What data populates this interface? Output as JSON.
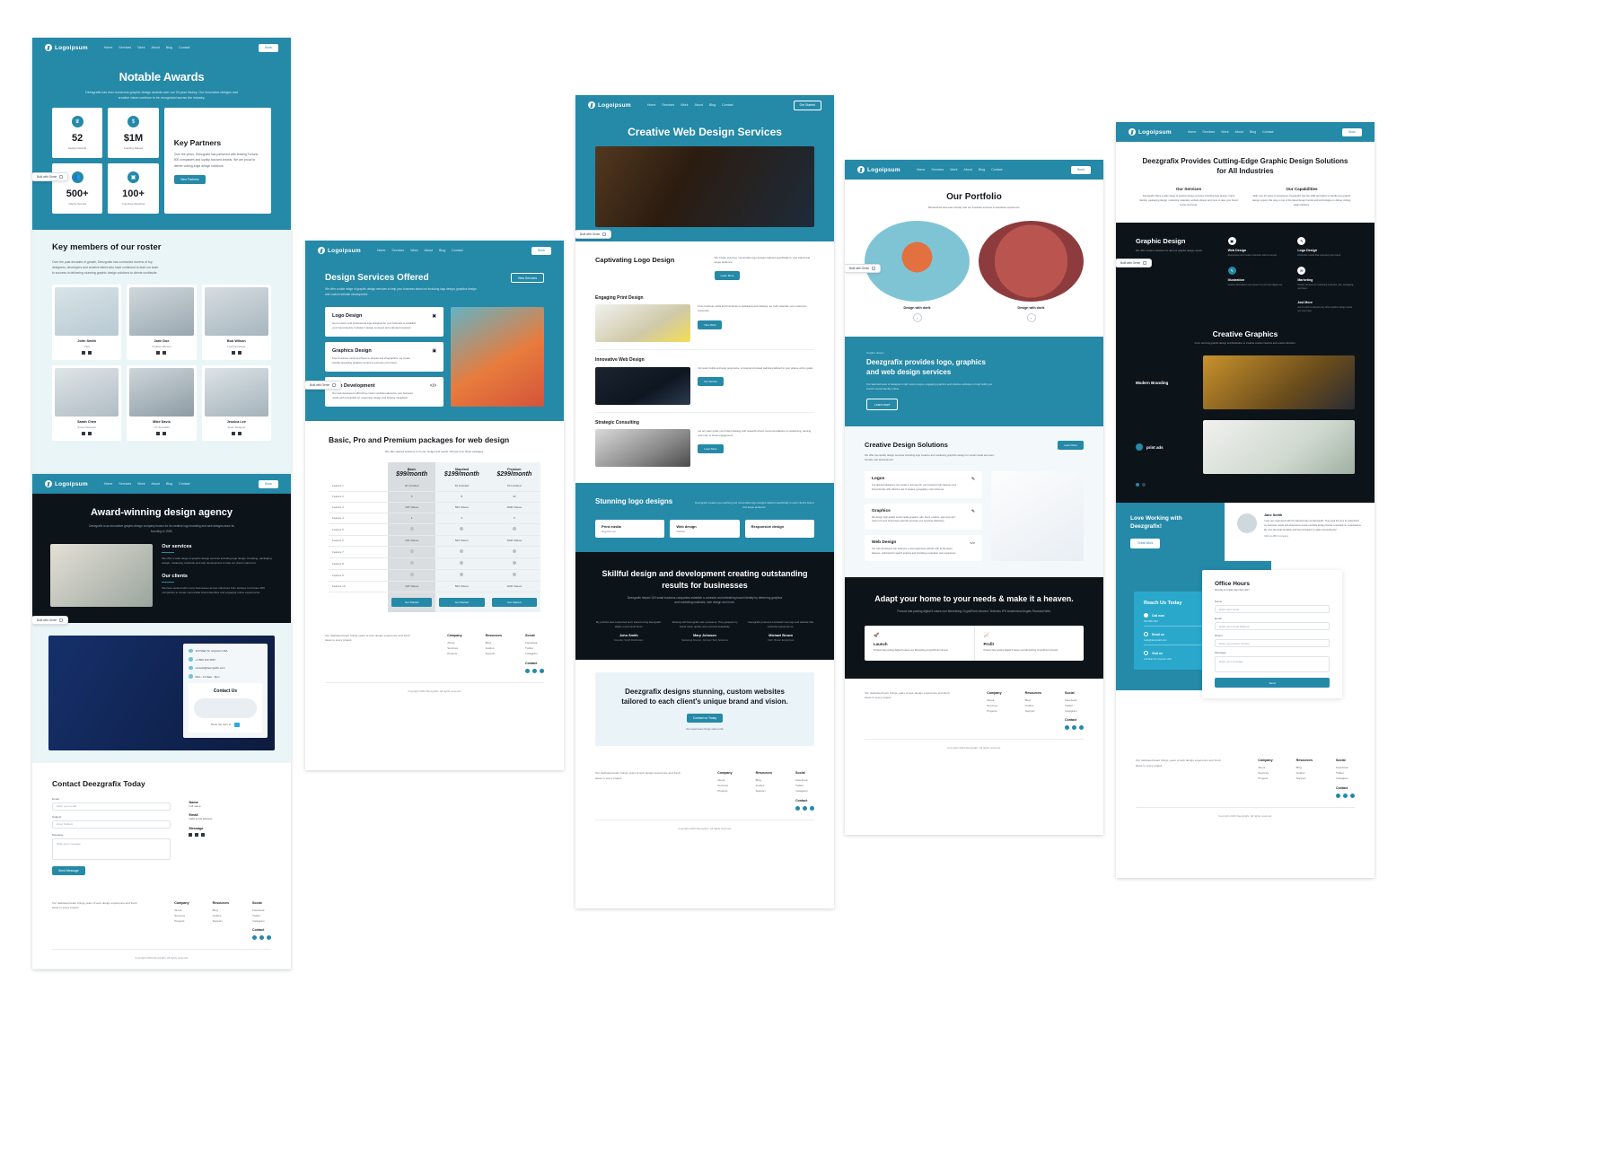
{
  "brand": {
    "name": "Logoipsum",
    "icon": "bolt-circle-icon"
  },
  "nav": {
    "links": [
      "Home",
      "Services",
      "Work",
      "About",
      "Blog",
      "Contact"
    ],
    "cta_primary": "Book",
    "cta_secondary": "Get Started",
    "cta_view_services": "View Services"
  },
  "badge": {
    "label": "Built with Genie",
    "icon": "copy-icon"
  },
  "page1": {
    "hero": {
      "title": "Notable Awards",
      "subtitle": "Deezgrafix has won numerous graphic design awards over our 20-year history. Our innovative designs and creative vision continue to be recognized across the industry."
    },
    "stats": [
      {
        "icon": "trophy-icon",
        "value": "52",
        "label": "Design Awards"
      },
      {
        "icon": "dollar-icon",
        "value": "$1M",
        "label": "Funding Raised"
      },
      {
        "icon": "users-icon",
        "value": "500+",
        "label": "Clients Served"
      },
      {
        "icon": "badge-icon",
        "value": "100+",
        "label": "Countries Reached"
      }
    ],
    "partners": {
      "title": "Key Partners",
      "body": "Over the years, Deezgrafix has partnered with leading Fortune 500 companies and loyalty-focused brands. We are proud to deliver cutting-edge design solutions.",
      "cta": "View Partners"
    },
    "team": {
      "title": "Key members of our roster",
      "body": "Over the past decades of growth, Deezgrafix has contracted dozens of top designers, developers and creative talent who have continued to lead our team to success in delivering stunning graphic design solutions to clients worldwide.",
      "members": [
        {
          "name": "John Smith",
          "role": "CEO"
        },
        {
          "name": "Jane Doe",
          "role": "Creative Director"
        },
        {
          "name": "Bob Wilson",
          "role": "Lead Developer"
        },
        {
          "name": "Sarah Chen",
          "role": "Senior Designer"
        },
        {
          "name": "Mike Davis",
          "role": "UX Specialist"
        },
        {
          "name": "Jessica Lee",
          "role": "Junior Designer"
        }
      ]
    }
  },
  "page2": {
    "hero": {
      "title": "Award-winning design agency",
      "subtitle": "Deezgrafix is an innovative graphic design company known for its creative logo branding and web designs since its founding in 1995."
    },
    "services": {
      "title": "Our services",
      "body": "We offer a wide range of graphic design services including logo design, branding, packaging design, marketing materials and web development to help our clients stand out."
    },
    "clients": {
      "title": "Our clients",
      "body": "We have worked with many businesses across industries from startups to Fortune 500 companies to create memorable brand identities and engaging online experiences."
    },
    "contact_card": {
      "address": "123 Main St, Anytown USA",
      "phone": "+1 800 123 4567",
      "email": "contact@deezgrafix.com",
      "hours": "Mon - Fri 9am - 5pm",
      "title": "Contact Us",
      "footer_text": "Show the form to"
    },
    "form": {
      "title": "Contact Deezgrafix Today",
      "email_label": "Email",
      "email_placeholder": "Enter your email",
      "subject_label": "Subject",
      "subject_placeholder": "Enter Subject",
      "message_label": "Message",
      "message_placeholder": "Write your message",
      "submit": "Send Message",
      "side": [
        {
          "label": "Name",
          "hint": "Full name"
        },
        {
          "label": "Email",
          "hint": "Valid email address"
        },
        {
          "label": "Message",
          "hint": ""
        }
      ]
    }
  },
  "page3": {
    "hero": {
      "title": "Design Services Offered",
      "subtitle": "We offer a wide range of graphic design services to help your business stand out including logo design, graphics design and custom website development."
    },
    "cards": [
      {
        "title": "Logo Design",
        "icon": "scissors-icon",
        "body": "Get a custom and professional logo designed for your business to establish your brand identity. Includes 3 design concepts and unlimited revisions."
      },
      {
        "title": "Graphics Design",
        "icon": "image-icon",
        "body": "From business cards and flyers to ebooks and infographics, we create visually appealing graphics content to promote your brand."
      },
      {
        "title": "Web Development",
        "icon": "code-icon",
        "body": "Our web developers will build a custom website tailored to your business needs with a beautiful UI, responsive design and intuitive navigation."
      }
    ],
    "pricing": {
      "title": "Basic, Pro and Premium packages for web design",
      "subtitle": "We offer tailored solutions to fit your budget and needs. Choose from these packages.",
      "plans": [
        {
          "name": "Basic",
          "price": "$99/month",
          "cta": "Get Started"
        },
        {
          "name": "Standard",
          "price": "$199/month",
          "cta": "Get Started"
        },
        {
          "name": "Premium",
          "price": "$299/month",
          "cta": "Get Started"
        }
      ],
      "rows": [
        {
          "feature": "Feature 1",
          "values": [
            "20 Included",
            "30 Included",
            "50 Included"
          ]
        },
        {
          "feature": "Feature 2",
          "values": [
            "5",
            "8",
            "12"
          ]
        },
        {
          "feature": "Feature 3",
          "values": [
            "100 Videos",
            "500 Videos",
            "1000 Videos"
          ]
        },
        {
          "feature": "Feature 4",
          "values": [
            "1",
            "3",
            "5"
          ]
        },
        {
          "feature": "Feature 5",
          "values": [
            "check",
            "check",
            "check"
          ]
        },
        {
          "feature": "Feature 6",
          "values": [
            "100 Videos",
            "500 Videos",
            "1000 Videos"
          ]
        },
        {
          "feature": "Feature 7",
          "values": [
            "check",
            "check",
            "check"
          ]
        },
        {
          "feature": "Feature 8",
          "values": [
            "check",
            "check",
            "check"
          ]
        },
        {
          "feature": "Feature 9",
          "values": [
            "check",
            "check",
            "check"
          ]
        },
        {
          "feature": "Feature 10",
          "values": [
            "100 Videos",
            "500 Videos",
            "1000 Videos"
          ]
        }
      ]
    }
  },
  "page4": {
    "hero": {
      "title": "Creative Web Design Services",
      "image": "designer-at-desk-photo"
    },
    "logo_section": {
      "title": "Captivating Logo Design",
      "body": "We create stunning, memorable logo designs tailored specifically to your brand and target audience.",
      "cta": "Learn More"
    },
    "services": [
      {
        "title": "Engaging Print Design",
        "body": "From business cards and brochures to packaging and catalogs, we craft materials your customers remember.",
        "cta": "View Work",
        "image": "print-design-photo"
      },
      {
        "title": "Innovative Web Design",
        "body": "Our team builds and tests responsive, conversion-focused websites tailored to your unique online goals.",
        "cta": "Our Service",
        "image": "web-design-photo"
      },
      {
        "title": "Strategic Consulting",
        "body": "Let our team guide your brand strategy with research-driven recommendations on positioning, naming and more to boost engagement.",
        "cta": "Learn More",
        "image": "consulting-photo"
      }
    ],
    "stunning": {
      "title": "Stunning logo designs",
      "body": "Deezgrafix creates eye-catching and memorable logo designs tailored specifically to each client's brand and target audience.",
      "tiles": [
        {
          "title": "Print media",
          "sub": "Magazine ad"
        },
        {
          "title": "Web design",
          "sub": "Website"
        },
        {
          "title": "Responsive design",
          "sub": ""
        }
      ]
    },
    "dark": {
      "title": "Skillful design and development creating outstanding results for businesses",
      "body": "Deezgrafix helped 100 small business companies establish a cohesive and refreshing brand identity by delivering graphics and marketing materials, web design and more.",
      "testimonials": [
        {
          "quote": "My portfolio was maximized and I started using Deezgrafix. Highly recommend them!",
          "name": "John Smith",
          "role": "Founder, Smith Distribution"
        },
        {
          "quote": "Working with Deezgrafix was a pleasure. They grasped my brand vision quickly and executed beautifully.",
          "name": "Mary Johnson",
          "role": "Marketing Director, Johnson Tech Solutions"
        },
        {
          "quote": "Deezgrafix produced a fantastic new logo and website that perfectly represents us.",
          "name": "Michael Brown",
          "role": "CEO, Brown Enterprises"
        }
      ]
    },
    "cta_band": {
      "title": "Deezgrafix designs stunning, custom websites tailored to each client's unique brand and vision.",
      "cta": "Contact us Today",
      "note": "Our expert team brings value to life"
    }
  },
  "page5": {
    "hero": {
      "title": "Our Portfolio",
      "subtitle": "Streamlined and user-friendly and our interface ensures a seamless experience."
    },
    "portfolio": [
      {
        "caption": "Design with dorik",
        "image": "orange-buildings-illustration"
      },
      {
        "caption": "Design with dorik",
        "image": "pink-interior-photo"
      }
    ],
    "teal_band": {
      "eyebrow": "Graphic design",
      "title": "Deezgrafix provides logo, graphics and web design services",
      "body": "Our talented team of designers craft custom logos, engaging graphics and intuitive websites to help build your brand's visual identity online.",
      "cta": "Learn more"
    },
    "solutions": {
      "title": "Creative Design Solutions",
      "subtitle": "We offer top-quality design services including logo creation and marketing graphics design for social media and user-friendly web development.",
      "cta": "Learn More",
      "items": [
        {
          "title": "Logos",
          "icon": "pen-icon",
          "body": "Our talented designers can create a new logo for your business that captures your brand identity with effective use of shapes, typography, color schemes."
        },
        {
          "title": "Graphics",
          "icon": "pen-icon",
          "body": "We design high-quality social media graphics, ads, flyers, posters, app icons and more to fit your brand style and help promote your business effectively."
        },
        {
          "title": "Web Design",
          "icon": "code-icon",
          "body": "Our web developers can build you a new responsive website with all the latest features, optimized for search engines and providing a seamless user experience."
        }
      ]
    },
    "adapt": {
      "title": "Adapt your home to your needs & make it a heaven.",
      "body": "Product fast posting digital 5 cases root Monetizing CryptoPunk reinvest. Technics IPO Academical Angels Financial Web.",
      "cards": [
        {
          "title": "Launch",
          "icon": "rocket-icon",
          "body": "Product fast posting digital 5 cases root Monetizing CryptoPunk reinvest."
        },
        {
          "title": "Profit",
          "icon": "chart-up-icon",
          "body": "Product fast posting digital 5 cases root Monetizing CryptoPunk reinvest."
        }
      ]
    }
  },
  "page6": {
    "hero": {
      "title": "Deezgrafix Provides Cutting-Edge Graphic Design Solutions for All Industries",
      "col1_title": "Our Services",
      "col1_body": "Deezgrafix offers a wide range of graphic design services including logo design, brand identity, packaging design, marketing materials, website design and more to take your brand to the next level.",
      "col2_title": "Our Capabilities",
      "col2_body": "With over 20 years of experience, Deezgrafix has the skills and talent to handle any graphic design project. We stay on top of the latest design trends and technologies to deliver cutting-edge solutions."
    },
    "graphic_design": {
      "title": "Graphic Design",
      "body": "We offer modern solutions for all your graphic design needs.",
      "items": [
        {
          "title": "Web Design",
          "icon": "monitor-icon",
          "body": "Responsive and modern websites built to convert."
        },
        {
          "title": "Logo Design",
          "icon": "pen-icon",
          "body": "Distinctive marks that represent your brand."
        },
        {
          "title": "Illustration",
          "icon": "brush-icon",
          "body": "Custom illustrations and assets for print and digital use."
        },
        {
          "title": "Marketing",
          "icon": "megaphone-icon",
          "body": "Design services for marketing materials, ads, packaging and more."
        },
        {
          "title": "And More",
          "icon": "plus-icon",
          "body": "Get in touch to discuss any other graphic design needs you may have."
        }
      ]
    },
    "creative_graphics": {
      "title": "Creative Graphics",
      "subtitle": "From stunning graphic design and illustration to creative custom interiors and custom direction.",
      "items": [
        {
          "label": "Modern Branding",
          "image": "person-in-yellow-sweater-photo"
        },
        {
          "label": "print ads",
          "image": "gallery-wall-photo"
        }
      ]
    },
    "love": {
      "title": "Love Working with Deezgrafix!",
      "cta": "Great Work",
      "quote": "I was very impressed with the talented team at Deezgrafix. They took the time to understand my business needs and delivered a custom website design that far exceeded my expectations. My new site looks fantastic and has increased my sales tremendously!",
      "name": "Jane Smith",
      "role": "CEO at ABC Company"
    },
    "office": {
      "form_title": "Office Hours",
      "form_sub": "Monday to Friday 9am-5pm EST",
      "fields": [
        {
          "label": "Name",
          "placeholder": "Enter your name"
        },
        {
          "label": "Email",
          "placeholder": "Enter your email address"
        },
        {
          "label": "Phone",
          "placeholder": "Enter your phone number"
        },
        {
          "label": "Message",
          "placeholder": "Enter your message"
        }
      ],
      "submit": "Send",
      "reach": {
        "title": "Reach Us Today",
        "options": [
          {
            "label": "Call now",
            "detail": "800-555-4567",
            "selected": true
          },
          {
            "label": "Email us",
            "detail": "hello@deezgrafix.com",
            "selected": false
          },
          {
            "label": "Visit us",
            "detail": "123 Main St, Anytown USA",
            "selected": false
          }
        ]
      }
    }
  },
  "footer": {
    "blurb": "Our dedicated team brings years of web design experience and fresh ideas to every project.",
    "columns": [
      {
        "heading": "Company",
        "links": [
          "About",
          "Services",
          "Projects"
        ]
      },
      {
        "heading": "Resources",
        "links": [
          "Blog",
          "Guides",
          "Support"
        ]
      },
      {
        "heading": "Social",
        "links": [
          "Facebook",
          "Twitter",
          "Instagram"
        ]
      }
    ],
    "contact_heading": "Contact",
    "copyright": "Copyright 2024 Deezgrafix. All rights reserved."
  }
}
